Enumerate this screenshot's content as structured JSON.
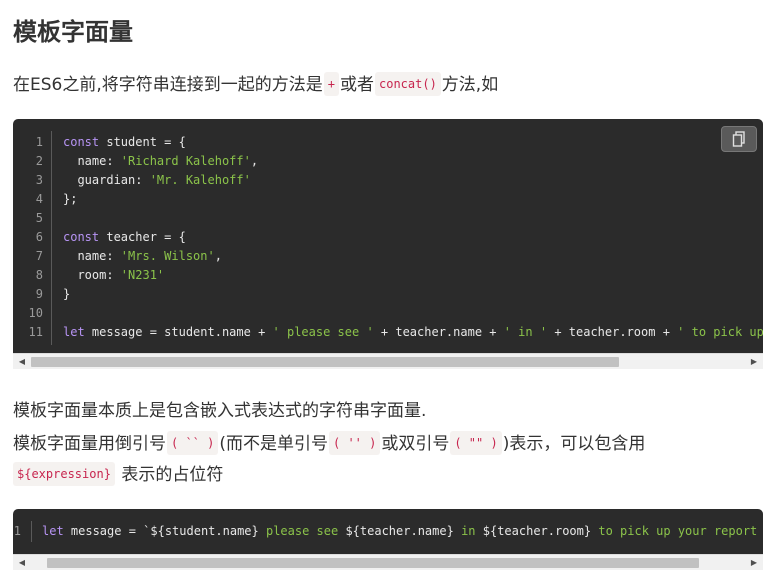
{
  "title": "模板字面量",
  "intro": {
    "prefix": "在ES6之前,将字符串连接到一起的方法是",
    "code1": "+",
    "middle": "或者",
    "code2": "concat()",
    "suffix": "方法,如"
  },
  "block1": {
    "copy_icon": "copy-icon",
    "line_numbers": [
      "1",
      "2",
      "3",
      "4",
      "5",
      "6",
      "7",
      "8",
      "9",
      "10",
      "11"
    ],
    "lines": [
      [
        {
          "t": "const",
          "c": "kw"
        },
        {
          "t": " student = {",
          "c": "op"
        }
      ],
      [
        {
          "t": "  name: ",
          "c": "op"
        },
        {
          "t": "'Richard Kalehoff'",
          "c": "str"
        },
        {
          "t": ",",
          "c": "op"
        }
      ],
      [
        {
          "t": "  guardian: ",
          "c": "op"
        },
        {
          "t": "'Mr. Kalehoff'",
          "c": "str"
        }
      ],
      [
        {
          "t": "};",
          "c": "op"
        }
      ],
      [],
      [
        {
          "t": "const",
          "c": "kw"
        },
        {
          "t": " teacher = {",
          "c": "op"
        }
      ],
      [
        {
          "t": "  name: ",
          "c": "op"
        },
        {
          "t": "'Mrs. Wilson'",
          "c": "str"
        },
        {
          "t": ",",
          "c": "op"
        }
      ],
      [
        {
          "t": "  room: ",
          "c": "op"
        },
        {
          "t": "'N231'",
          "c": "str"
        }
      ],
      [
        {
          "t": "}",
          "c": "op"
        }
      ],
      [],
      [
        {
          "t": "let",
          "c": "kw"
        },
        {
          "t": " message = student.name + ",
          "c": "op"
        },
        {
          "t": "' please see '",
          "c": "str"
        },
        {
          "t": " + teacher.name + ",
          "c": "op"
        },
        {
          "t": "' in '",
          "c": "str"
        },
        {
          "t": " + teacher.room + ",
          "c": "op"
        },
        {
          "t": "' to pick up your report card.'",
          "c": "str"
        },
        {
          "t": ";",
          "c": "op"
        }
      ]
    ]
  },
  "para2": {
    "line1": "模板字面量本质上是包含嵌入式表达式的字符串字面量.",
    "line2_prefix": "模板字面量用倒引号",
    "code_backtick": "( `` )",
    "line2_mid": "(而不是单引号",
    "code_single": "( '' )",
    "line2_mid2": "或双引号",
    "code_double": "( \"\" )",
    "line2_suffix": ")表示，可以包含用",
    "code_expr": "${expression}",
    "line3_suffix": "表示的占位符"
  },
  "block2": {
    "line_numbers": [
      "1"
    ],
    "lines": [
      [
        {
          "t": "let",
          "c": "kw"
        },
        {
          "t": " message = `${student.name} ",
          "c": "op"
        },
        {
          "t": "please see",
          "c": "tpl"
        },
        {
          "t": " ${teacher.name} ",
          "c": "op"
        },
        {
          "t": "in",
          "c": "tpl"
        },
        {
          "t": " ${teacher.room} ",
          "c": "op"
        },
        {
          "t": "to pick up your report card.",
          "c": "tpl"
        },
        {
          "t": "`;",
          "c": "op"
        }
      ]
    ]
  },
  "scrollbar": {
    "left_arrow": "◀",
    "right_arrow": "▶"
  }
}
